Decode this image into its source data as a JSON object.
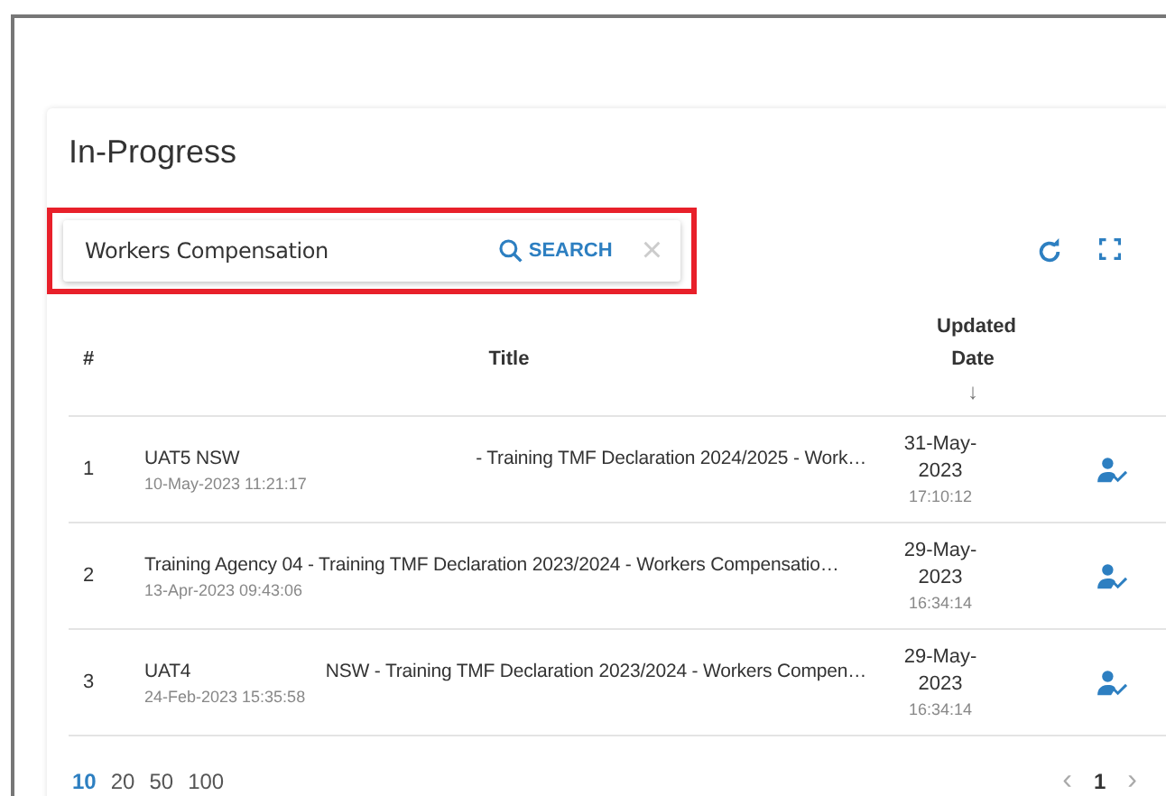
{
  "panel": {
    "title": "In-Progress"
  },
  "search": {
    "value": "Workers Compensation",
    "button": "SEARCH",
    "clear": "×",
    "highlighted": true
  },
  "table": {
    "columns": [
      "#",
      "Title",
      "Updated Date"
    ],
    "sort_arrow": "↓",
    "rows": [
      {
        "index": "1",
        "title_parts": [
          "UAT5 NSW",
          "- Training TMF Declaration 2024/2025 - Work…"
        ],
        "created": "10-May-2023 11:21:17",
        "updated_date": "31-May-2023",
        "updated_time": "17:10:12"
      },
      {
        "index": "2",
        "title_parts": [
          "Training Agency 04 - Training TMF Declaration 2023/2024 - Workers Compensatio…"
        ],
        "created": "13-Apr-2023 09:43:06",
        "updated_date": "29-May-2023",
        "updated_time": "16:34:14"
      },
      {
        "index": "3",
        "title_parts": [
          "UAT4",
          "NSW - Training TMF Declaration 2023/2024 - Workers Compen…"
        ],
        "created": "24-Feb-2023 15:35:58",
        "updated_date": "29-May-2023",
        "updated_time": "16:34:14"
      }
    ]
  },
  "page_sizes": [
    {
      "label": "10",
      "selected": true
    },
    {
      "label": "20",
      "selected": false
    },
    {
      "label": "50",
      "selected": false
    },
    {
      "label": "100",
      "selected": false
    }
  ],
  "pager": {
    "prev": "‹",
    "page": "1",
    "next": "›"
  }
}
